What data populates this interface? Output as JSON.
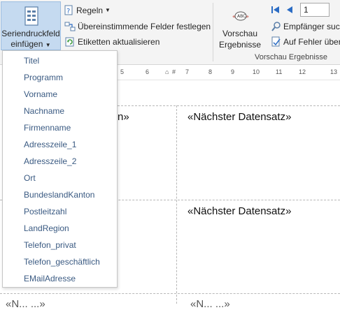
{
  "ribbon": {
    "merge_field_button": {
      "line1": "Seriendruckfeld",
      "line2": "einfügen",
      "icon": "merge-field-icon"
    },
    "rules_label": "Regeln",
    "match_fields_label": "Übereinstimmende Felder festlegen",
    "update_labels_label": "Etiketten aktualisieren",
    "preview_results": {
      "line1": "Vorschau",
      "line2": "Ergebnisse",
      "icon_text": "ABC"
    },
    "record_number": "1",
    "find_recipient_label": "Empfänger such",
    "check_errors_label": "Auf Fehler über",
    "group_label": "Vorschau Ergebnisse"
  },
  "ruler": {
    "ticks": [
      "5",
      "6",
      "7",
      "8",
      "9",
      "10",
      "11",
      "12",
      "13"
    ]
  },
  "document": {
    "cell_text_1": "n»",
    "next_record_1": "«Nächster Datensatz»",
    "next_record_2": "«Nächster Datensatz»",
    "bottom_left_partial": "«N... ...»",
    "bottom_right_partial": "«N... ...»"
  },
  "dropdown": {
    "items": [
      "Titel",
      "Programm",
      "Vorname",
      "Nachname",
      "Firmenname",
      "Adresszeile_1",
      "Adresszeile_2",
      "Ort",
      "BundeslandKanton",
      "Postleitzahl",
      "LandRegion",
      "Telefon_privat",
      "Telefon_geschäftlich",
      "EMailAdresse"
    ]
  },
  "colors": {
    "accent_selected": "#c5daf0",
    "link_text": "#3a5a82",
    "nav_arrow": "#2b6cc4"
  }
}
